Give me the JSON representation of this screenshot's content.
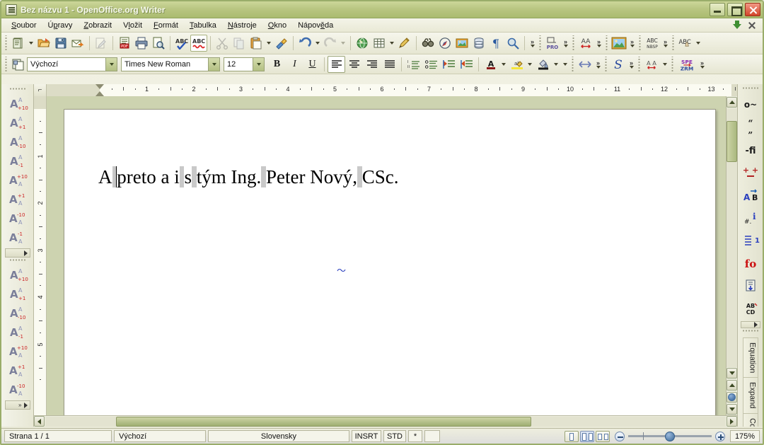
{
  "window": {
    "title": "Bez názvu 1 - OpenOffice.org Writer",
    "app_icon": "writer-document-icon",
    "minimize_label": "Minimalizovat",
    "maximize_label": "Maximalizovat",
    "close_label": "Zavřít"
  },
  "menubar": {
    "items": [
      {
        "label": "Soubor",
        "accel": "S"
      },
      {
        "label": "Úpravy",
        "accel": "p"
      },
      {
        "label": "Zobrazit",
        "accel": "Z"
      },
      {
        "label": "Vložit",
        "accel": "l"
      },
      {
        "label": "Formát",
        "accel": "F"
      },
      {
        "label": "Tabulka",
        "accel": "T"
      },
      {
        "label": "Nástroje",
        "accel": "N"
      },
      {
        "label": "Okno",
        "accel": "O"
      },
      {
        "label": "Nápověda",
        "accel": "ě"
      }
    ],
    "right_icons": [
      {
        "name": "download-updates-icon",
        "tooltip": "Stáhnout"
      },
      {
        "name": "close-document-icon",
        "tooltip": "Zavřít dokument"
      }
    ]
  },
  "standard_toolbar": {
    "buttons": [
      {
        "name": "new-document-button",
        "icon": "new-doc-icon",
        "disabled": false,
        "dropdown": true
      },
      {
        "name": "open-button",
        "icon": "open-folder-icon",
        "disabled": false
      },
      {
        "name": "save-button",
        "icon": "floppy-save-icon",
        "disabled": false
      },
      {
        "name": "email-document-button",
        "icon": "envelope-arrow-icon",
        "disabled": false
      },
      {
        "name": "edit-file-button",
        "icon": "edit-pencil-icon",
        "disabled": true
      },
      {
        "name": "export-pdf-button",
        "icon": "pdf-icon",
        "disabled": false
      },
      {
        "name": "print-button",
        "icon": "printer-icon",
        "disabled": false
      },
      {
        "name": "print-preview-button",
        "icon": "page-magnifier-icon",
        "disabled": false
      },
      {
        "name": "spelling-button",
        "icon": "abc-check-icon",
        "disabled": false
      },
      {
        "name": "autospellcheck-button",
        "icon": "abc-wave-icon",
        "disabled": false,
        "active": true
      },
      {
        "name": "cut-button",
        "icon": "scissors-icon",
        "disabled": true
      },
      {
        "name": "copy-button",
        "icon": "copy-icon",
        "disabled": true
      },
      {
        "name": "paste-button",
        "icon": "clipboard-icon",
        "disabled": false,
        "dropdown": true
      },
      {
        "name": "clone-formatting-button",
        "icon": "paintbrush-icon",
        "disabled": false
      },
      {
        "name": "undo-button",
        "icon": "undo-arrow-icon",
        "disabled": false,
        "dropdown": true
      },
      {
        "name": "redo-button",
        "icon": "redo-arrow-icon",
        "disabled": true,
        "dropdown": true
      },
      {
        "name": "hyperlink-button",
        "icon": "globe-icon",
        "disabled": false
      },
      {
        "name": "insert-table-button",
        "icon": "table-grid-icon",
        "disabled": false,
        "dropdown": true
      },
      {
        "name": "show-draw-functions",
        "icon": "pencil-draw-icon",
        "disabled": false
      },
      {
        "name": "find-replace-button",
        "icon": "binoculars-icon",
        "disabled": false
      },
      {
        "name": "navigator-button",
        "icon": "compass-icon",
        "disabled": false
      },
      {
        "name": "gallery-button",
        "icon": "picture-frame-icon",
        "disabled": false
      },
      {
        "name": "data-sources-button",
        "icon": "database-icon",
        "disabled": false
      },
      {
        "name": "formatting-marks-button",
        "icon": "pilcrow-icon",
        "disabled": false
      },
      {
        "name": "zoom-button",
        "icon": "magnifier-icon",
        "disabled": false
      }
    ],
    "overflow_label": "»"
  },
  "extension_toolbars": [
    {
      "name": "pro-toolbar",
      "icon": "pro-label-icon",
      "label": "PRO"
    },
    {
      "name": "kerning-toolbar",
      "icon": "aa-spacing-icon",
      "label": "AA"
    },
    {
      "name": "image-toolbar",
      "icon": "landscape-image-icon",
      "label": ""
    },
    {
      "name": "nbsp-toolbar",
      "icon": "abc-nbsp-icon",
      "label": "NBSP"
    },
    {
      "name": "abc-hand-toolbar",
      "icon": "abc-hand-icon",
      "label": ""
    }
  ],
  "formatting_toolbar": {
    "paragraph_style": {
      "value": "Výchozí",
      "name": "paragraph-style-combo"
    },
    "font_name": {
      "value": "Times New Roman",
      "name": "font-name-combo"
    },
    "font_size": {
      "value": "12",
      "name": "font-size-combo"
    },
    "style_apply_icon": "apply-style-icon",
    "buttons": [
      {
        "name": "bold-button",
        "label": "B",
        "active": false
      },
      {
        "name": "italic-button",
        "label": "I",
        "active": false
      },
      {
        "name": "underline-button",
        "label": "U",
        "active": false
      },
      {
        "name": "align-left-button",
        "icon": "align-left-icon",
        "active": true
      },
      {
        "name": "align-center-button",
        "icon": "align-center-icon",
        "active": false
      },
      {
        "name": "align-right-button",
        "icon": "align-right-icon",
        "active": false
      },
      {
        "name": "align-justify-button",
        "icon": "align-justify-icon",
        "active": false
      },
      {
        "name": "numbered-list-button",
        "icon": "numbered-list-icon",
        "active": false
      },
      {
        "name": "bulleted-list-button",
        "icon": "bulleted-list-icon",
        "active": false
      },
      {
        "name": "decrease-indent-button",
        "icon": "decrease-indent-icon",
        "active": false
      },
      {
        "name": "increase-indent-button",
        "icon": "increase-indent-icon",
        "active": false
      },
      {
        "name": "font-color-button",
        "icon": "font-color-icon",
        "dropdown": true
      },
      {
        "name": "highlighting-button",
        "icon": "highlight-icon",
        "dropdown": true
      },
      {
        "name": "background-color-button",
        "icon": "background-color-icon",
        "dropdown": true
      }
    ],
    "extras": [
      {
        "name": "spacing-tool",
        "icon": "double-arrow-icon"
      },
      {
        "name": "script-tool",
        "icon": "script-s-icon"
      },
      {
        "name": "aa-tracking-tool",
        "icon": "aa-arrow-icon"
      },
      {
        "name": "spe-zrm-tool",
        "icon": "spe-zrm-icon",
        "label_top": "SPE",
        "label_bottom": "ZRM"
      }
    ]
  },
  "left_toolbar": {
    "group1_name": "font-size-step-toolbar-upper",
    "group2_name": "font-size-step-toolbar-lower",
    "buttons_group1": [
      {
        "name": "font-up-10-button",
        "main": "A",
        "sup": "A",
        "sub": "+10"
      },
      {
        "name": "font-up-1-button",
        "main": "A",
        "sup": "A",
        "sub": "+1"
      },
      {
        "name": "font-down-10-button",
        "main": "A",
        "sup": "A",
        "sub": "-10"
      },
      {
        "name": "font-down-1-button",
        "main": "A",
        "sup": "A",
        "sub": "-1"
      },
      {
        "name": "font2-up-10-button",
        "main": "A",
        "sup": "+10",
        "sub": "A"
      },
      {
        "name": "font2-up-1-button",
        "main": "A",
        "sup": "+1",
        "sub": "A"
      },
      {
        "name": "font2-down-10-button",
        "main": "A",
        "sup": "-10",
        "sub": "A"
      },
      {
        "name": "font2-down-1-button",
        "main": "A",
        "sup": "-1",
        "sub": "A"
      }
    ],
    "buttons_group2": [
      {
        "name": "font3-up-10-button",
        "main": "A",
        "sup": "A",
        "sub": "+10"
      },
      {
        "name": "font3-up-1-button",
        "main": "A",
        "sup": "A",
        "sub": "+1"
      },
      {
        "name": "font3-down-10-button",
        "main": "A",
        "sup": "A",
        "sub": "-10"
      },
      {
        "name": "font3-down-1-button",
        "main": "A",
        "sup": "A",
        "sub": "-1"
      },
      {
        "name": "font4-up-10-button",
        "main": "A",
        "sup": "+10",
        "sub": "A"
      },
      {
        "name": "font4-up-1-button",
        "main": "A",
        "sup": "+1",
        "sub": "A"
      },
      {
        "name": "font4-down-10-button",
        "main": "A",
        "sup": "-10",
        "sub": "A"
      }
    ]
  },
  "right_toolbar": {
    "buttons": [
      {
        "name": "degree-tilde-button",
        "glyph": "o~",
        "color": "#1a1a1a"
      },
      {
        "name": "quotes-button",
        "glyph": "“„",
        "color": "#1a1a1a"
      },
      {
        "name": "ligature-fi-button",
        "glyph": "-fi",
        "color": "#1a1a1a"
      },
      {
        "name": "insert-symbol-button",
        "glyph": "+.+",
        "color": "#b22222"
      },
      {
        "name": "ab-swap-button",
        "glyph": "A⇄B",
        "color": "#2a3fbe"
      },
      {
        "name": "numbering-info-button",
        "glyph": "#.i",
        "color": "#2a3fbe"
      },
      {
        "name": "line-number-button",
        "glyph": "≡ 1",
        "color": "#2a3fbe"
      },
      {
        "name": "fo-button",
        "glyph": "fo",
        "color": "#cc1111"
      },
      {
        "name": "page-insert-button",
        "glyph": "↓",
        "color": "#2a3fbe"
      },
      {
        "name": "abcd-button",
        "glyph": "AB CD",
        "color": "#1a1a1a"
      }
    ],
    "tabs": [
      {
        "name": "equation-panel-tab",
        "label": "Equation"
      },
      {
        "name": "expand-panel-tab",
        "label": "Expand"
      },
      {
        "name": "config-panel-tab",
        "label": "Config"
      }
    ]
  },
  "ruler": {
    "horizontal_name": "horizontal-ruler",
    "vertical_name": "vertical-ruler",
    "corner_icon": "tab-stop-left-icon",
    "unit": "cm",
    "h_labels": [
      "1",
      "2",
      "3",
      "4",
      "5",
      "6",
      "7",
      "8",
      "9",
      "10",
      "11",
      "12",
      "13"
    ],
    "v_labels": [
      "1",
      "2",
      "3",
      "4",
      "5"
    ]
  },
  "document": {
    "page_name": "document-page",
    "text_runs": [
      {
        "t": "A",
        "nbsp": false
      },
      {
        "t": " ",
        "nbsp": true
      },
      {
        "t": "preto a i",
        "nbsp": false
      },
      {
        "t": " ",
        "nbsp": true
      },
      {
        "t": "s",
        "nbsp": false
      },
      {
        "t": " ",
        "nbsp": true
      },
      {
        "t": "tým Ing.",
        "nbsp": false
      },
      {
        "t": " ",
        "nbsp": true
      },
      {
        "t": "Peter Nový,",
        "nbsp": false
      },
      {
        "t": " ",
        "nbsp": true
      },
      {
        "t": "CSc.",
        "nbsp": false
      }
    ],
    "plain_text": "A preto a i s tým Ing. Peter Nový, CSc.",
    "spellcheck_underline": true
  },
  "scrollbars": {
    "vertical_name": "vertical-scrollbar",
    "horizontal_name": "horizontal-scrollbar",
    "nav_up_name": "previous-page-button",
    "nav_dot_name": "navigation-object-button",
    "nav_down_name": "next-page-button"
  },
  "statusbar": {
    "page": "Strana 1 / 1",
    "page_style": "Výchozí",
    "language": "Slovensky",
    "insert_mode": "INSRT",
    "selection_mode": "STD",
    "modified": "*",
    "view_buttons": [
      {
        "name": "single-page-view-button",
        "selected": false
      },
      {
        "name": "multi-page-view-button",
        "selected": true
      },
      {
        "name": "book-view-button",
        "selected": false
      }
    ],
    "zoom_out_label": "−",
    "zoom_in_label": "+",
    "zoom_value": "175%",
    "zoom_slider_percent": 50
  },
  "colors": {
    "titlebar_start": "#cdd79a",
    "titlebar_end": "#aabb6f",
    "accent_green": "#9aad6a",
    "toolbar_bg": "#eeeede",
    "canvas_bg": "#cdd3b0",
    "page_bg": "#ffffff",
    "nbsp_mark": "#c9c9c9",
    "spell_underline": "#2a3fbe",
    "close_red": "#d2442a"
  }
}
